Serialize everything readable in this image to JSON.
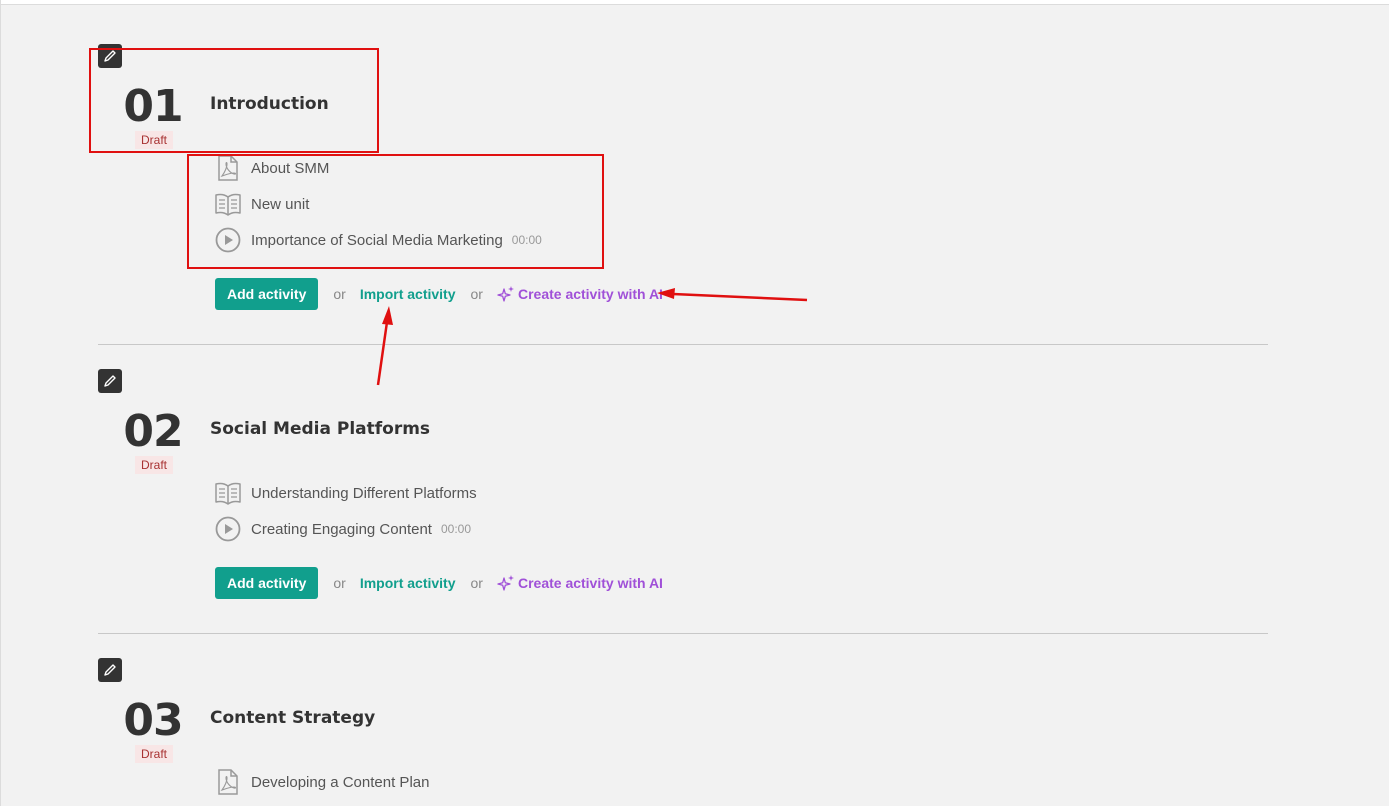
{
  "sections": [
    {
      "number": "01",
      "status": "Draft",
      "title": "Introduction",
      "items": [
        {
          "icon": "pdf-icon",
          "label": "About SMM",
          "duration": ""
        },
        {
          "icon": "book-icon",
          "label": "New unit",
          "duration": ""
        },
        {
          "icon": "play-icon",
          "label": "Importance of Social Media Marketing",
          "duration": "00:00"
        }
      ]
    },
    {
      "number": "02",
      "status": "Draft",
      "title": "Social Media Platforms",
      "items": [
        {
          "icon": "book-icon",
          "label": "Understanding Different Platforms",
          "duration": ""
        },
        {
          "icon": "play-icon",
          "label": "Creating Engaging Content",
          "duration": "00:00"
        }
      ]
    },
    {
      "number": "03",
      "status": "Draft",
      "title": "Content Strategy",
      "items": [
        {
          "icon": "pdf-icon",
          "label": "Developing a Content Plan",
          "duration": ""
        }
      ]
    }
  ],
  "actions": {
    "add_activity": "Add activity",
    "or": "or",
    "import_activity": "Import activity",
    "create_ai": "Create activity with AI"
  },
  "colors": {
    "accent": "#119f8d",
    "ai": "#a050d8",
    "draft": "#a83232",
    "annotation": "#e01010"
  }
}
